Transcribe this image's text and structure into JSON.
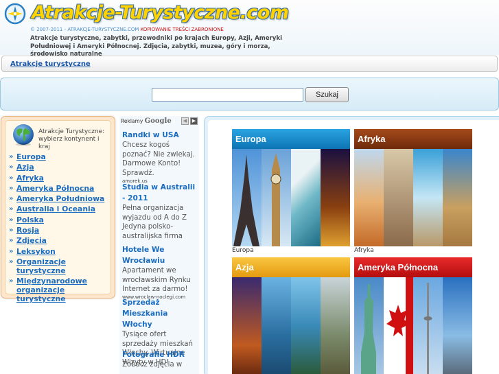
{
  "header": {
    "logo_text": "Atrakcje-Turystyczne.com",
    "copyright_text": "© 2007-2011 - atrakcje-turystyczne.com",
    "copyright_warning": "KOPIOWANIE TREŚCI ZABRONIONE",
    "tagline": "Atrakcje turystyczne, zabytki, przewodniki po krajach Europy, Azji, Ameryki Południowej i Ameryki Północnej. Zdjęcia, zabytki, muzea, góry i morza, środowisko naturalne"
  },
  "breadcrumb": {
    "label": "Atrakcje turystyczne"
  },
  "search": {
    "value": "",
    "button_label": "Szukaj"
  },
  "sidebar": {
    "title": "Atrakcje Turystyczne: wybierz kontynent i kraj",
    "items": [
      {
        "label": "Europa"
      },
      {
        "label": "Azja"
      },
      {
        "label": "Afryka"
      },
      {
        "label": "Ameryka Północna"
      },
      {
        "label": "Ameryka Południowa"
      },
      {
        "label": "Australia i Oceania"
      },
      {
        "label": "Polska"
      },
      {
        "label": "Rosja"
      },
      {
        "label": "Zdjęcia"
      },
      {
        "label": "Leksykon"
      },
      {
        "label": "Organizacje turystyczne"
      },
      {
        "label": "Międzynarodowe organizacje turystyczne"
      }
    ]
  },
  "ads": {
    "header_label": "Reklamy",
    "header_brand": "Google",
    "prev_icon": "◀",
    "next_icon": "▶",
    "items": [
      {
        "title": "Randki w USA",
        "text": "Chcesz kogoś poznać? Nie zwlekaj. Darmowe Konto! Sprawdź.",
        "url": "amorek.us"
      },
      {
        "title": "Studia w Australii - 2011",
        "text": "Pełna organizacja wyjazdu od A do Z Jedyna polsko-australijska firma",
        "url": ""
      },
      {
        "title": "Hotele We Wrocławiu",
        "text": "Apartament we wrocławskim Rynku Internet za darmo!",
        "url": "www.wroclaw-noclegi.com"
      },
      {
        "title": "Sprzedaż Mieszkania Włochy",
        "text": "Tysiące ofert sprzedaży mieszkań Włochy. Wirtualne Wizyty w HD!",
        "url": ""
      },
      {
        "title": "Fotografie HDR",
        "text": "Zobacz zdjęcia w",
        "url": ""
      }
    ]
  },
  "continents": [
    {
      "banner": "Europa",
      "caption": "Europa",
      "banner_color": "#1a8fd0"
    },
    {
      "banner": "Afryka",
      "caption": "Afryka",
      "banner_color": "#8a3a12"
    },
    {
      "banner": "Azja",
      "caption": "",
      "banner_color": "#f0b21c"
    },
    {
      "banner": "Ameryka Północna",
      "caption": "",
      "banner_color": "#d11a1a"
    }
  ],
  "colors": {
    "link": "#1a6cc0",
    "logo_yellow": "#ffd200",
    "sidebar_bg": "#fde6cb",
    "content_bg": "#e2f1fa"
  }
}
